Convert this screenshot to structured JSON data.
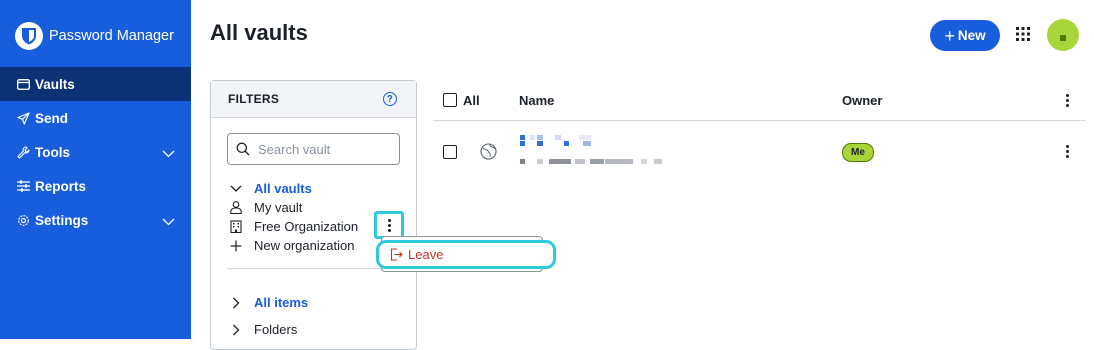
{
  "app": {
    "brand": "Password Manager"
  },
  "nav": {
    "vaults": "Vaults",
    "send": "Send",
    "tools": "Tools",
    "reports": "Reports",
    "settings": "Settings"
  },
  "header": {
    "title": "All vaults",
    "new_label": "New"
  },
  "filters": {
    "heading": "FILTERS",
    "search_placeholder": "Search vault",
    "vaults": {
      "all": "All vaults",
      "my_vault": "My vault",
      "free_org": "Free Organization",
      "new_org": "New organization"
    },
    "all_items": "All items",
    "folders": "Folders"
  },
  "context_menu": {
    "leave": "Leave"
  },
  "table": {
    "col_all": "All",
    "col_name": "Name",
    "col_owner": "Owner",
    "rows": [
      {
        "owner_badge": "Me"
      }
    ]
  },
  "colors": {
    "sidebar": "#175ddc",
    "sidebar_active": "#0c3276",
    "accent": "#175ddc",
    "danger": "#c83522",
    "highlight": "#2bcbdd",
    "avatar": "#a8d53a"
  }
}
